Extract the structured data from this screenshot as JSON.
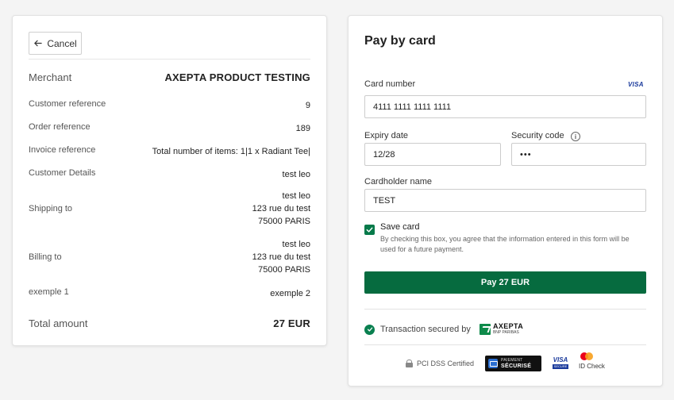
{
  "summary": {
    "cancel_label": "Cancel",
    "merchant_label": "Merchant",
    "merchant_value": "AXEPTA PRODUCT TESTING",
    "rows": [
      {
        "label": "Customer reference",
        "value": "9"
      },
      {
        "label": "Order reference",
        "value": "189"
      },
      {
        "label": "Invoice reference",
        "value": "Total number of items: 1|1 x Radiant Tee|"
      },
      {
        "label": "Customer Details",
        "value": "test leo"
      }
    ],
    "shipping": {
      "label": "Shipping to",
      "line1": "test leo",
      "line2": "123 rue du test",
      "line3": "75000 PARIS"
    },
    "billing": {
      "label": "Billing to",
      "line1": "test leo",
      "line2": "123 rue du test",
      "line3": "75000 PARIS"
    },
    "extra": {
      "label": "exemple 1",
      "value": "exemple 2"
    },
    "total_label": "Total amount",
    "total_value": "27 EUR"
  },
  "payment": {
    "title": "Pay by card",
    "card_number_label": "Card number",
    "card_brand": "VISA",
    "card_number_value": "4111 1111 1111 1111",
    "expiry_label": "Expiry date",
    "expiry_value": "12/28",
    "security_label": "Security code",
    "security_value": "•••",
    "info_icon": "i",
    "cardholder_label": "Cardholder name",
    "cardholder_value": "TEST",
    "save_card_label": "Save card",
    "save_card_checked": true,
    "save_card_desc": "By checking this box, you agree that the information entered in this form will be used for a future payment.",
    "pay_button_label": "Pay 27 EUR",
    "secured_label": "Transaction secured by",
    "axepta_name": "AXEPTA",
    "axepta_sub": "BNP PARIBAS",
    "pci_label": "PCI DSS Certified",
    "paiement_line1": "PAIEMENT",
    "paiement_line2": "SÉCURISÉ",
    "visa_badge": "VISA",
    "visa_badge_sub": "SECURE",
    "idcheck_label": "ID Check"
  },
  "colors": {
    "accent_green": "#066b3f",
    "background": "#f4f4f4"
  }
}
